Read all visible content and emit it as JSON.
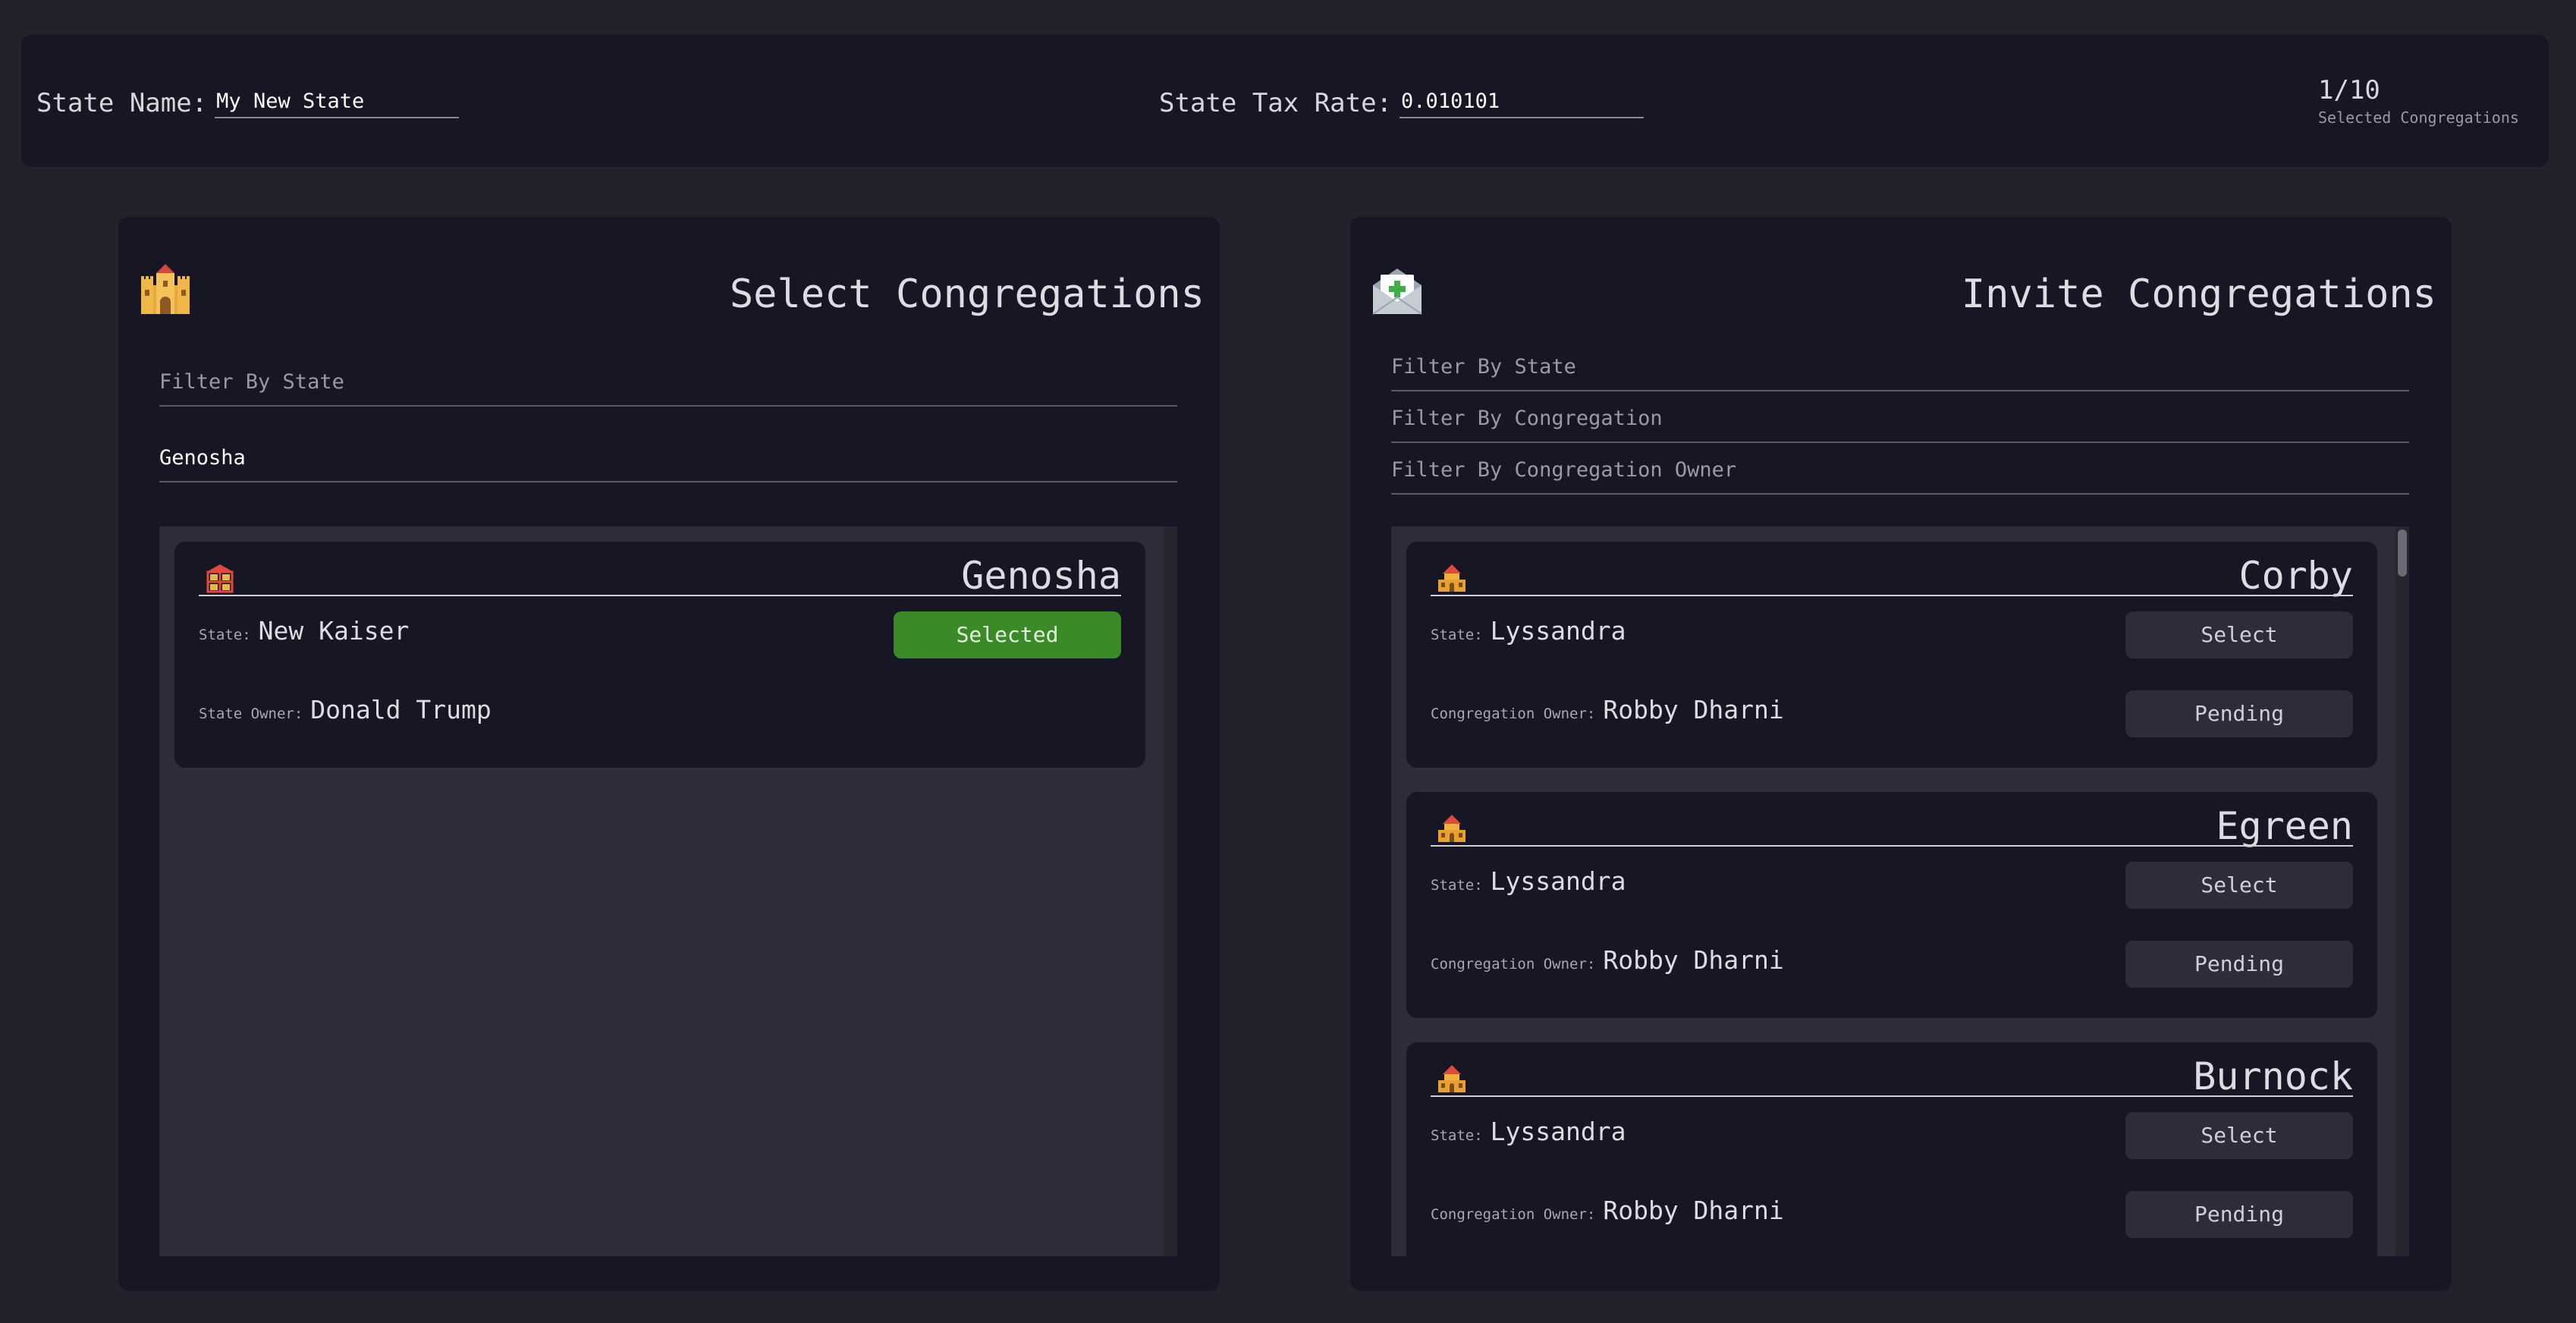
{
  "header": {
    "state_name_label": "State Name:",
    "state_name_value": "My New State",
    "tax_rate_label": "State Tax Rate:",
    "tax_rate_value": "0.010101",
    "selected_count": "1/10",
    "selected_label": "Selected Congregations"
  },
  "select_panel": {
    "icon": "castle-icon",
    "title": "Select Congregations",
    "filter_placeholder": "Filter By State",
    "filter_value": "Genosha",
    "cards": [
      {
        "icon": "shrine-icon",
        "title": "Genosha",
        "state_label": "State:",
        "state_value": "New Kaiser",
        "owner_label": "State Owner:",
        "owner_value": "Donald Trump",
        "button_label": "Selected"
      }
    ]
  },
  "invite_panel": {
    "icon": "envelope-plus-icon",
    "title": "Invite Congregations",
    "filter_state_placeholder": "Filter By State",
    "filter_congregation_placeholder": "Filter By Congregation",
    "filter_owner_placeholder": "Filter By Congregation Owner",
    "cards": [
      {
        "icon": "temple-icon",
        "title": "Corby",
        "state_label": "State:",
        "state_value": "Lyssandra",
        "owner_label": "Congregation Owner:",
        "owner_value": "Robby Dharni",
        "select_label": "Select",
        "pending_label": "Pending"
      },
      {
        "icon": "temple-icon",
        "title": "Egreen",
        "state_label": "State:",
        "state_value": "Lyssandra",
        "owner_label": "Congregation Owner:",
        "owner_value": "Robby Dharni",
        "select_label": "Select",
        "pending_label": "Pending"
      },
      {
        "icon": "temple-icon",
        "title": "Burnock",
        "state_label": "State:",
        "state_value": "Lyssandra",
        "owner_label": "Congregation Owner:",
        "owner_value": "Robby Dharni",
        "select_label": "Select",
        "pending_label": "Pending"
      }
    ]
  },
  "colors": {
    "background": "#22222d",
    "panel": "#161624",
    "list_bg": "#2d2d3a",
    "selected_green": "#3b8a28",
    "button_dark": "#2c2c3a"
  }
}
